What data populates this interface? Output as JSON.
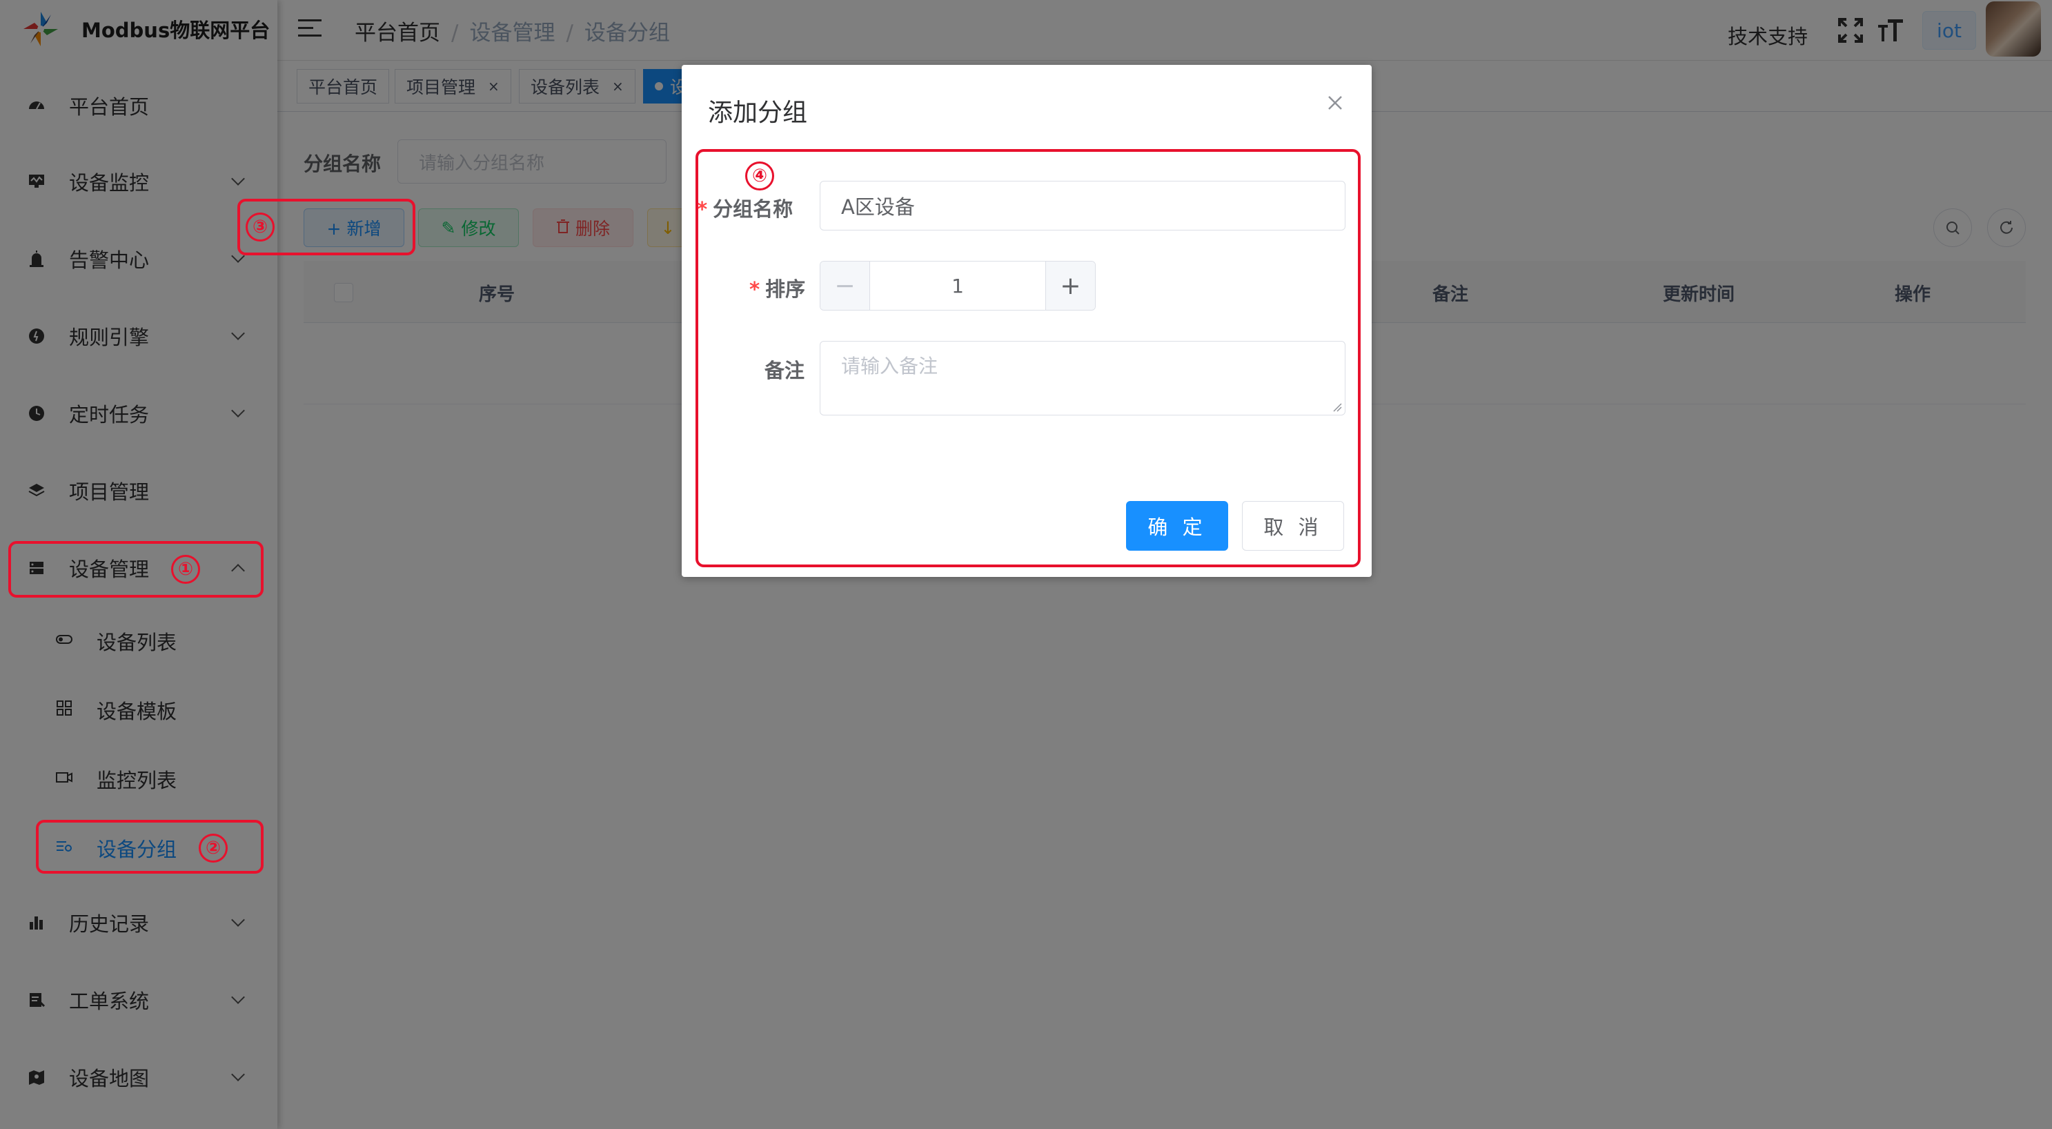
{
  "app": {
    "title": "Modbus物联网平台"
  },
  "sidebar": {
    "items": [
      {
        "label": "平台首页",
        "icon": "dashboard-icon"
      },
      {
        "label": "设备监控",
        "icon": "monitor-icon"
      },
      {
        "label": "告警中心",
        "icon": "alarm-icon"
      },
      {
        "label": "规则引擎",
        "icon": "rule-icon"
      },
      {
        "label": "定时任务",
        "icon": "clock-icon"
      },
      {
        "label": "项目管理",
        "icon": "layers-icon"
      },
      {
        "label": "设备管理",
        "icon": "server-icon"
      },
      {
        "label": "历史记录",
        "icon": "bar-chart-icon"
      },
      {
        "label": "工单系统",
        "icon": "ticket-icon"
      },
      {
        "label": "设备地图",
        "icon": "map-icon"
      }
    ],
    "sub_items": [
      {
        "label": "设备列表",
        "icon": "toggle-icon"
      },
      {
        "label": "设备模板",
        "icon": "grid-icon"
      },
      {
        "label": "监控列表",
        "icon": "camera-icon"
      },
      {
        "label": "设备分组",
        "icon": "group-icon"
      }
    ]
  },
  "header": {
    "breadcrumb": [
      "平台首页",
      "设备管理",
      "设备分组"
    ],
    "tech_support": "技术支持",
    "user_tag": "iot"
  },
  "tags": [
    {
      "label": "平台首页",
      "closable": false
    },
    {
      "label": "项目管理",
      "closable": true
    },
    {
      "label": "设备列表",
      "closable": true
    },
    {
      "label": "设",
      "closable": false
    }
  ],
  "tag_close_glyph": "×",
  "page": {
    "search_label": "分组名称",
    "search_placeholder": "请输入分组名称",
    "toolbar": {
      "add": "+ 新增",
      "edit": "修改",
      "delete": "删除"
    },
    "table_headers": [
      "序号",
      "备注",
      "更新时间",
      "操作"
    ]
  },
  "dialog": {
    "title": "添加分组",
    "name_label": "分组名称",
    "name_value": "A区设备",
    "sort_label": "排序",
    "sort_value": "1",
    "remark_label": "备注",
    "remark_placeholder": "请输入备注",
    "required_mark": "*",
    "confirm": "确 定",
    "cancel": "取 消",
    "minus": "−",
    "plus": "+"
  },
  "annotations": [
    "①",
    "②",
    "③",
    "④"
  ],
  "colors": {
    "primary": "#1890ff",
    "annotation_red": "#e8112d",
    "danger": "#ff4949",
    "success": "#13ce66"
  }
}
